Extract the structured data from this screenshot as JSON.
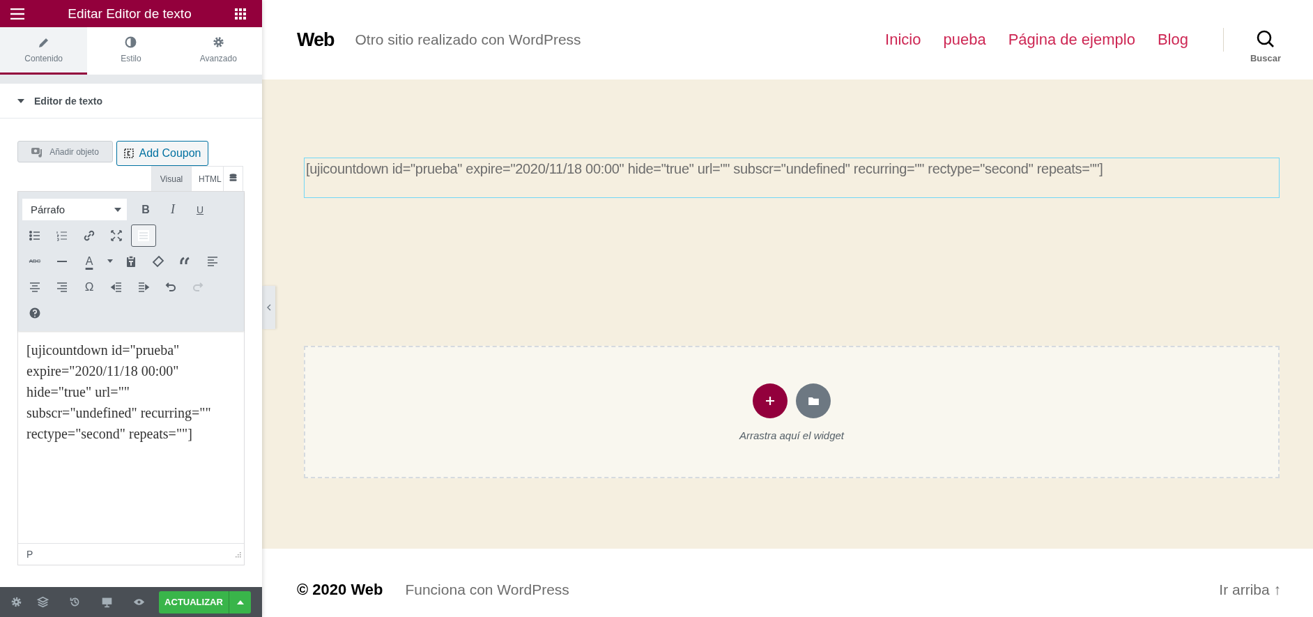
{
  "panel": {
    "title": "Editar Editor de texto",
    "tabs": [
      {
        "label": "Contenido",
        "selected": true
      },
      {
        "label": "Estilo",
        "selected": false
      },
      {
        "label": "Avanzado",
        "selected": false
      }
    ],
    "section": {
      "title": "Editor de texto",
      "expanded": true
    },
    "media_buttons": [
      {
        "label": "Añadir objeto",
        "kind": "media"
      },
      {
        "label": "Add Coupon",
        "kind": "coupon"
      }
    ],
    "editor_tabs": [
      {
        "label": "Visual",
        "selected": true
      },
      {
        "label": "HTML",
        "selected": false
      }
    ],
    "format_select": "Párrafo",
    "toolbar": [
      [
        {
          "kind": "bold",
          "glyph": "B",
          "pressed": false,
          "disabled": false
        },
        {
          "kind": "italic",
          "glyph": "I",
          "pressed": false,
          "disabled": false
        },
        {
          "kind": "underline",
          "glyph": "U",
          "pressed": false,
          "disabled": false
        }
      ],
      [
        {
          "kind": "bullist",
          "pressed": false,
          "disabled": false
        },
        {
          "kind": "numlist",
          "pressed": false,
          "disabled": false
        },
        {
          "kind": "link",
          "pressed": false,
          "disabled": false
        },
        {
          "kind": "fullscreen",
          "pressed": false,
          "disabled": false
        },
        {
          "kind": "toggle",
          "pressed": true,
          "disabled": false
        }
      ],
      [
        {
          "kind": "strike",
          "glyph": "ABC",
          "pressed": false,
          "disabled": false
        },
        {
          "kind": "hr",
          "pressed": false,
          "disabled": false
        },
        {
          "kind": "forecolor",
          "glyph": "A",
          "pressed": false,
          "disabled": false
        },
        {
          "kind": "caret",
          "pressed": false,
          "disabled": false
        },
        {
          "kind": "paste",
          "pressed": false,
          "disabled": false
        },
        {
          "kind": "eraser",
          "pressed": false,
          "disabled": false
        },
        {
          "kind": "quote",
          "pressed": false,
          "disabled": false
        },
        {
          "kind": "alignleft",
          "pressed": false,
          "disabled": false
        }
      ],
      [
        {
          "kind": "aligncenter",
          "pressed": false,
          "disabled": false
        },
        {
          "kind": "alignright",
          "pressed": false,
          "disabled": false
        },
        {
          "kind": "charmap",
          "glyph": "Ω",
          "pressed": false,
          "disabled": false
        },
        {
          "kind": "outdent",
          "pressed": false,
          "disabled": false
        },
        {
          "kind": "indent",
          "pressed": false,
          "disabled": false
        },
        {
          "kind": "undo",
          "pressed": false,
          "disabled": false
        },
        {
          "kind": "redo",
          "pressed": false,
          "disabled": true
        }
      ],
      [
        {
          "kind": "help",
          "pressed": false,
          "disabled": false
        }
      ]
    ],
    "editor_text": "[ujicountdown id=\"prueba\" expire=\"2020/11/18 00:00\" hide=\"true\" url=\"\" subscr=\"undefined\" recurring=\"\" rectype=\"second\" repeats=\"\"]",
    "status_path": "P",
    "update_button": "ACTUALIZAR"
  },
  "site": {
    "title": "Web",
    "tagline": "Otro sitio realizado con WordPress",
    "nav": [
      "Inicio",
      "pueba",
      "Página de ejemplo",
      "Blog"
    ],
    "search_label": "Buscar",
    "shortcode": "[ujicountdown id=\"prueba\" expire=\"2020/11/18 00:00\" hide=\"true\" url=\"\" subscr=\"undefined\" recurring=\"\" rectype=\"second\" repeats=\"\"]",
    "drop_hint": "Arrastra aquí el widget",
    "copyright": "© 2020 Web",
    "powered": "Funciona con WordPress",
    "to_top": "Ir arriba ↑"
  }
}
